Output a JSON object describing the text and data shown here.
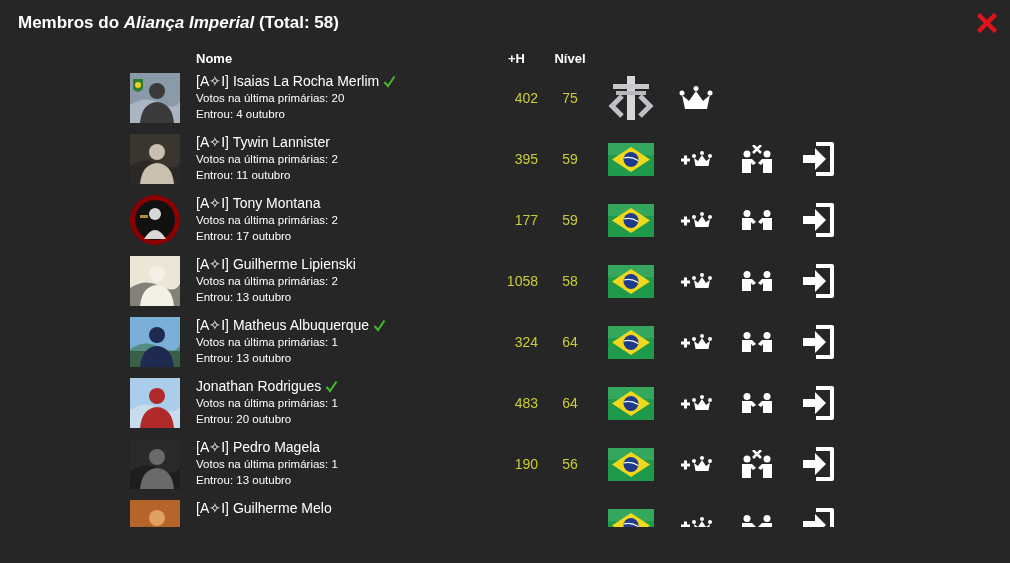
{
  "modal": {
    "title": "Membros do *Aliança Imperial* (Total: 58)",
    "columns": [
      "Nome",
      "+H",
      "Nível"
    ],
    "members": [
      {
        "kind": "leader",
        "name": "[A✧I] Isaias La Rocha Merlim",
        "verified": true,
        "votes": "Votos na última primárias: 20",
        "joined": "Entrou: 4 outubro",
        "plus_h": "402",
        "nivel": "75"
      },
      {
        "kind": "member",
        "name": "[A✧I] Tywin Lannister",
        "verified": false,
        "votes": "Votos na última primárias: 2",
        "joined": "Entrou: 11 outubro",
        "plus_h": "395",
        "nivel": "59",
        "handshake_crossed": true
      },
      {
        "kind": "member",
        "name": "[A✧I] Tony Montana",
        "verified": false,
        "votes": "Votos na última primárias: 2",
        "joined": "Entrou: 17 outubro",
        "plus_h": "177",
        "nivel": "59",
        "handshake_crossed": false
      },
      {
        "kind": "member",
        "name": "[A✧I] Guilherme Lipienski",
        "verified": false,
        "votes": "Votos na última primárias: 2",
        "joined": "Entrou: 13 outubro",
        "plus_h": "1058",
        "nivel": "58",
        "handshake_crossed": false
      },
      {
        "kind": "member",
        "name": "[A✧I] Matheus Albuquerque",
        "verified": true,
        "votes": "Votos na última primárias: 1",
        "joined": "Entrou: 13 outubro",
        "plus_h": "324",
        "nivel": "64",
        "handshake_crossed": false
      },
      {
        "kind": "member",
        "name": "Jonathan Rodrigues",
        "verified": true,
        "votes": "Votos na última primárias: 1",
        "joined": "Entrou: 20 outubro",
        "plus_h": "483",
        "nivel": "64",
        "handshake_crossed": false
      },
      {
        "kind": "member",
        "name": "[A✧I] Pedro Magela",
        "verified": false,
        "votes": "Votos na última primárias: 1",
        "joined": "Entrou: 13 outubro",
        "plus_h": "190",
        "nivel": "56",
        "handshake_crossed": true
      },
      {
        "kind": "member",
        "name": "[A✧I] Guilherme Melo",
        "verified": false,
        "handshake_crossed": false
      }
    ]
  }
}
